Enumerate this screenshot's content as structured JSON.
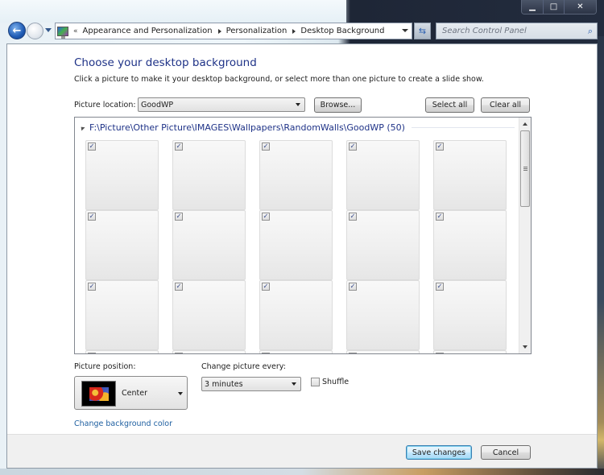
{
  "window": {
    "caption_buttons": [
      {
        "name": "minimize",
        "glyph": "▁"
      },
      {
        "name": "maximize",
        "glyph": "□"
      },
      {
        "name": "close",
        "glyph": "✕"
      }
    ]
  },
  "navbar": {
    "back_icon": "←",
    "overflow_chevron": "«",
    "breadcrumbs": [
      "Appearance and Personalization",
      "Personalization",
      "Desktop Background"
    ],
    "refresh_icon": "⇆",
    "search": {
      "placeholder": "Search Control Panel",
      "value": "",
      "icon": "⌕"
    }
  },
  "main": {
    "title": "Choose your desktop background",
    "description": "Click a picture to make it your desktop background, or select more than one picture to create a slide show.",
    "picture_location": {
      "label": "Picture location:",
      "value": "GoodWP"
    },
    "browse_label": "Browse...",
    "select_all_label": "Select all",
    "clear_all_label": "Clear all",
    "picture_group": {
      "title": "F:\\Picture\\Other Picture\\IMAGES\\Wallpapers\\RandomWalls\\GoodWP (50)",
      "count": 50,
      "visible_rows": 3,
      "columns": 5,
      "all_checked": true
    },
    "picture_position": {
      "label": "Picture position:",
      "value": "Center"
    },
    "change_every": {
      "label": "Change picture every:",
      "value": "3 minutes"
    },
    "shuffle": {
      "label": "Shuffle",
      "checked": false
    },
    "change_bg_color_link": "Change background color"
  },
  "footer": {
    "save_label": "Save changes",
    "cancel_label": "Cancel"
  }
}
